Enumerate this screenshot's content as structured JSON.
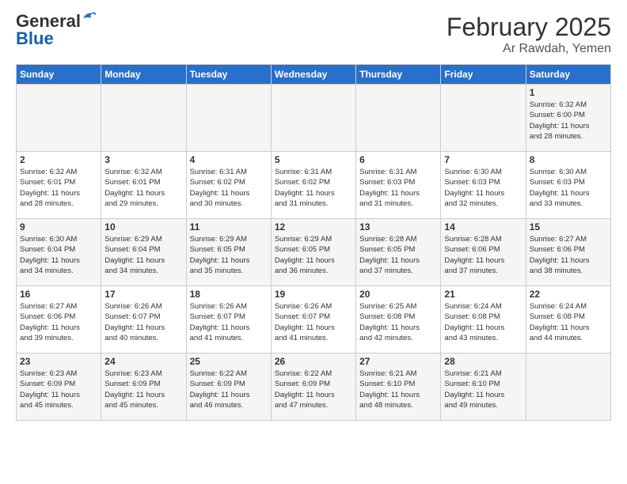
{
  "logo": {
    "general": "General",
    "blue": "Blue"
  },
  "title": "February 2025",
  "subtitle": "Ar Rawdah, Yemen",
  "days_header": [
    "Sunday",
    "Monday",
    "Tuesday",
    "Wednesday",
    "Thursday",
    "Friday",
    "Saturday"
  ],
  "weeks": [
    [
      {
        "day": "",
        "info": ""
      },
      {
        "day": "",
        "info": ""
      },
      {
        "day": "",
        "info": ""
      },
      {
        "day": "",
        "info": ""
      },
      {
        "day": "",
        "info": ""
      },
      {
        "day": "",
        "info": ""
      },
      {
        "day": "1",
        "info": "Sunrise: 6:32 AM\nSunset: 6:00 PM\nDaylight: 11 hours\nand 28 minutes."
      }
    ],
    [
      {
        "day": "2",
        "info": "Sunrise: 6:32 AM\nSunset: 6:01 PM\nDaylight: 11 hours\nand 28 minutes."
      },
      {
        "day": "3",
        "info": "Sunrise: 6:32 AM\nSunset: 6:01 PM\nDaylight: 11 hours\nand 29 minutes."
      },
      {
        "day": "4",
        "info": "Sunrise: 6:31 AM\nSunset: 6:02 PM\nDaylight: 11 hours\nand 30 minutes."
      },
      {
        "day": "5",
        "info": "Sunrise: 6:31 AM\nSunset: 6:02 PM\nDaylight: 11 hours\nand 31 minutes."
      },
      {
        "day": "6",
        "info": "Sunrise: 6:31 AM\nSunset: 6:03 PM\nDaylight: 11 hours\nand 31 minutes."
      },
      {
        "day": "7",
        "info": "Sunrise: 6:30 AM\nSunset: 6:03 PM\nDaylight: 11 hours\nand 32 minutes."
      },
      {
        "day": "8",
        "info": "Sunrise: 6:30 AM\nSunset: 6:03 PM\nDaylight: 11 hours\nand 33 minutes."
      }
    ],
    [
      {
        "day": "9",
        "info": "Sunrise: 6:30 AM\nSunset: 6:04 PM\nDaylight: 11 hours\nand 34 minutes."
      },
      {
        "day": "10",
        "info": "Sunrise: 6:29 AM\nSunset: 6:04 PM\nDaylight: 11 hours\nand 34 minutes."
      },
      {
        "day": "11",
        "info": "Sunrise: 6:29 AM\nSunset: 6:05 PM\nDaylight: 11 hours\nand 35 minutes."
      },
      {
        "day": "12",
        "info": "Sunrise: 6:29 AM\nSunset: 6:05 PM\nDaylight: 11 hours\nand 36 minutes."
      },
      {
        "day": "13",
        "info": "Sunrise: 6:28 AM\nSunset: 6:05 PM\nDaylight: 11 hours\nand 37 minutes."
      },
      {
        "day": "14",
        "info": "Sunrise: 6:28 AM\nSunset: 6:06 PM\nDaylight: 11 hours\nand 37 minutes."
      },
      {
        "day": "15",
        "info": "Sunrise: 6:27 AM\nSunset: 6:06 PM\nDaylight: 11 hours\nand 38 minutes."
      }
    ],
    [
      {
        "day": "16",
        "info": "Sunrise: 6:27 AM\nSunset: 6:06 PM\nDaylight: 11 hours\nand 39 minutes."
      },
      {
        "day": "17",
        "info": "Sunrise: 6:26 AM\nSunset: 6:07 PM\nDaylight: 11 hours\nand 40 minutes."
      },
      {
        "day": "18",
        "info": "Sunrise: 6:26 AM\nSunset: 6:07 PM\nDaylight: 11 hours\nand 41 minutes."
      },
      {
        "day": "19",
        "info": "Sunrise: 6:26 AM\nSunset: 6:07 PM\nDaylight: 11 hours\nand 41 minutes."
      },
      {
        "day": "20",
        "info": "Sunrise: 6:25 AM\nSunset: 6:08 PM\nDaylight: 11 hours\nand 42 minutes."
      },
      {
        "day": "21",
        "info": "Sunrise: 6:24 AM\nSunset: 6:08 PM\nDaylight: 11 hours\nand 43 minutes."
      },
      {
        "day": "22",
        "info": "Sunrise: 6:24 AM\nSunset: 6:08 PM\nDaylight: 11 hours\nand 44 minutes."
      }
    ],
    [
      {
        "day": "23",
        "info": "Sunrise: 6:23 AM\nSunset: 6:09 PM\nDaylight: 11 hours\nand 45 minutes."
      },
      {
        "day": "24",
        "info": "Sunrise: 6:23 AM\nSunset: 6:09 PM\nDaylight: 11 hours\nand 45 minutes."
      },
      {
        "day": "25",
        "info": "Sunrise: 6:22 AM\nSunset: 6:09 PM\nDaylight: 11 hours\nand 46 minutes."
      },
      {
        "day": "26",
        "info": "Sunrise: 6:22 AM\nSunset: 6:09 PM\nDaylight: 11 hours\nand 47 minutes."
      },
      {
        "day": "27",
        "info": "Sunrise: 6:21 AM\nSunset: 6:10 PM\nDaylight: 11 hours\nand 48 minutes."
      },
      {
        "day": "28",
        "info": "Sunrise: 6:21 AM\nSunset: 6:10 PM\nDaylight: 11 hours\nand 49 minutes."
      },
      {
        "day": "",
        "info": ""
      }
    ]
  ]
}
